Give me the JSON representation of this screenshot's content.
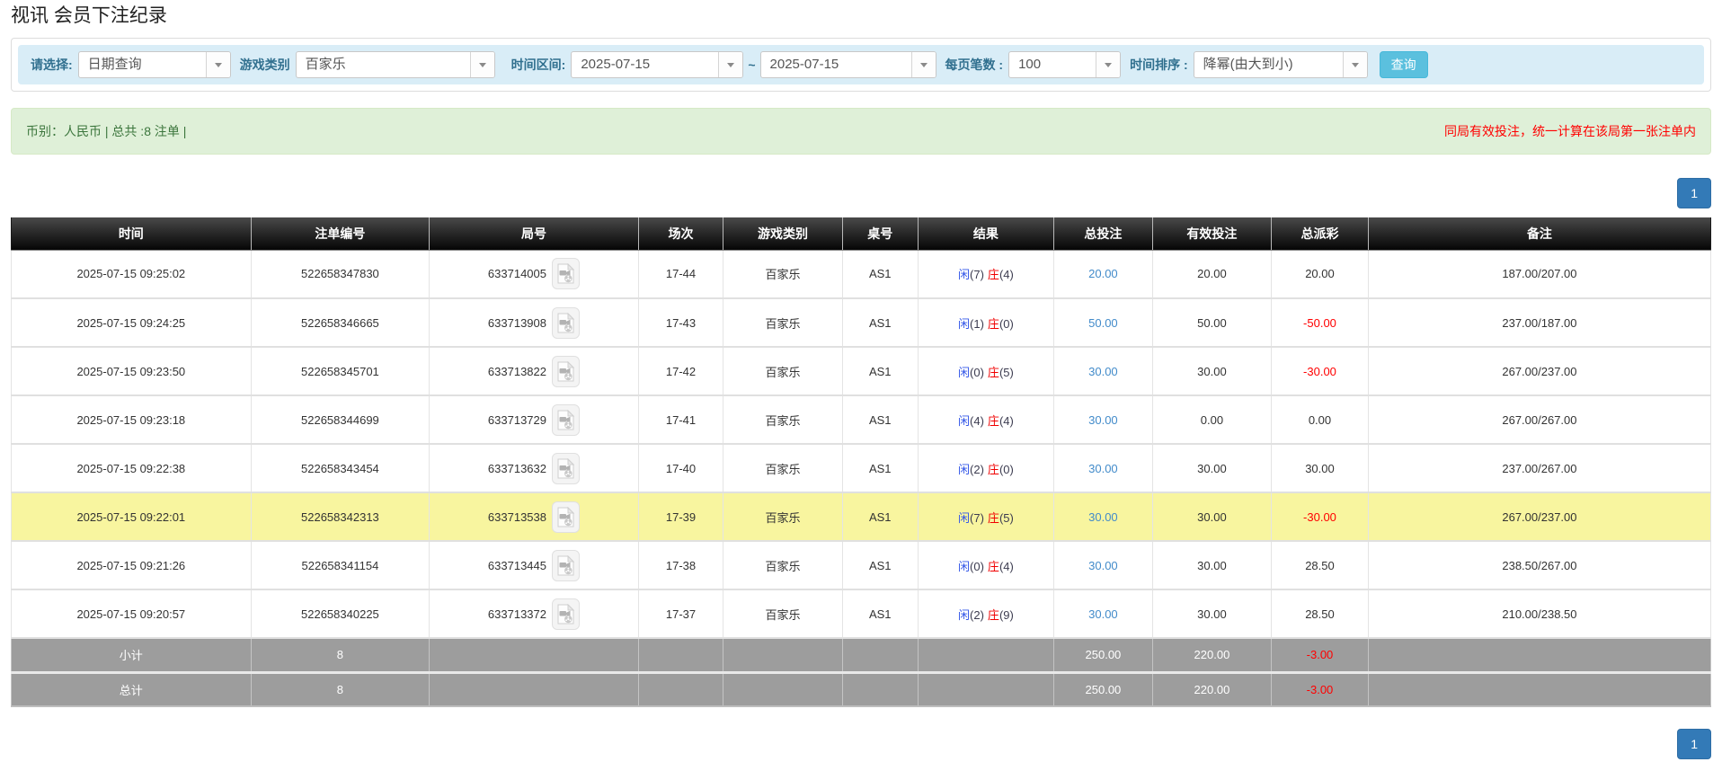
{
  "page": {
    "title": "视讯 会员下注纪录"
  },
  "colors": {
    "filter_bar_bg": "#d9edf7",
    "search_button": "#5bc0de",
    "summary_bg": "#dff0d8",
    "summary_text_green": "#3c763d",
    "alert_red": "#ff0000",
    "link_blue": "#428bca",
    "pagination_blue": "#337ab7",
    "highlight_yellow": "#f8f59f",
    "footer_gray": "#9d9d9d",
    "header_black": "#1a1a1a"
  },
  "filters": {
    "select_label": "请选择:",
    "select_value": "日期查询",
    "game_type_label": "游戏类别",
    "game_type_value": "百家乐",
    "time_range_label": "时间区间:",
    "date_from": "2025-07-15",
    "tilde": "~",
    "date_to": "2025-07-15",
    "page_size_label": "每页笔数 :",
    "page_size_value": "100",
    "sort_label": "时间排序 :",
    "sort_value": "降幂(由大到小)",
    "search_button": "查询"
  },
  "summary": {
    "left": "币别：人民币 | 总共 :8 注单 |",
    "right": "同局有效投注，统一计算在该局第一张注单内"
  },
  "pagination": {
    "top": "1",
    "bottom": "1"
  },
  "table": {
    "headers": [
      "时间",
      "注单编号",
      "局号",
      "场次",
      "游戏类别",
      "桌号",
      "结果",
      "总投注",
      "有效投注",
      "总派彩",
      "备注"
    ],
    "col_widths": [
      "14.1%",
      "10.5%",
      "12.3%",
      "5.0%",
      "7.0%",
      "4.45%",
      "8.0%",
      "5.8%",
      "7.0%",
      "5.7%",
      "20.15%"
    ],
    "rows": [
      {
        "time": "2025-07-15 09:25:02",
        "bet_id": "522658347830",
        "round": "633714005",
        "session": "17-44",
        "game": "百家乐",
        "table_no": "AS1",
        "result": {
          "player": "闲",
          "player_score": "(7)",
          "banker": "庄",
          "banker_score": "(4)"
        },
        "total_bet": "20.00",
        "valid_bet": "20.00",
        "payout": "20.00",
        "remark": "187.00/207.00",
        "highlighted": false
      },
      {
        "time": "2025-07-15 09:24:25",
        "bet_id": "522658346665",
        "round": "633713908",
        "session": "17-43",
        "game": "百家乐",
        "table_no": "AS1",
        "result": {
          "player": "闲",
          "player_score": "(1)",
          "banker": "庄",
          "banker_score": "(0)"
        },
        "total_bet": "50.00",
        "valid_bet": "50.00",
        "payout": "-50.00",
        "remark": "237.00/187.00",
        "highlighted": false
      },
      {
        "time": "2025-07-15 09:23:50",
        "bet_id": "522658345701",
        "round": "633713822",
        "session": "17-42",
        "game": "百家乐",
        "table_no": "AS1",
        "result": {
          "player": "闲",
          "player_score": "(0)",
          "banker": "庄",
          "banker_score": "(5)"
        },
        "total_bet": "30.00",
        "valid_bet": "30.00",
        "payout": "-30.00",
        "remark": "267.00/237.00",
        "highlighted": false
      },
      {
        "time": "2025-07-15 09:23:18",
        "bet_id": "522658344699",
        "round": "633713729",
        "session": "17-41",
        "game": "百家乐",
        "table_no": "AS1",
        "result": {
          "player": "闲",
          "player_score": "(4)",
          "banker": "庄",
          "banker_score": "(4)"
        },
        "total_bet": "30.00",
        "valid_bet": "0.00",
        "payout": "0.00",
        "remark": "267.00/267.00",
        "highlighted": false
      },
      {
        "time": "2025-07-15 09:22:38",
        "bet_id": "522658343454",
        "round": "633713632",
        "session": "17-40",
        "game": "百家乐",
        "table_no": "AS1",
        "result": {
          "player": "闲",
          "player_score": "(2)",
          "banker": "庄",
          "banker_score": "(0)"
        },
        "total_bet": "30.00",
        "valid_bet": "30.00",
        "payout": "30.00",
        "remark": "237.00/267.00",
        "highlighted": false
      },
      {
        "time": "2025-07-15 09:22:01",
        "bet_id": "522658342313",
        "round": "633713538",
        "session": "17-39",
        "game": "百家乐",
        "table_no": "AS1",
        "result": {
          "player": "闲",
          "player_score": "(7)",
          "banker": "庄",
          "banker_score": "(5)"
        },
        "total_bet": "30.00",
        "valid_bet": "30.00",
        "payout": "-30.00",
        "remark": "267.00/237.00",
        "highlighted": true
      },
      {
        "time": "2025-07-15 09:21:26",
        "bet_id": "522658341154",
        "round": "633713445",
        "session": "17-38",
        "game": "百家乐",
        "table_no": "AS1",
        "result": {
          "player": "闲",
          "player_score": "(0)",
          "banker": "庄",
          "banker_score": "(4)"
        },
        "total_bet": "30.00",
        "valid_bet": "30.00",
        "payout": "28.50",
        "remark": "238.50/267.00",
        "highlighted": false
      },
      {
        "time": "2025-07-15 09:20:57",
        "bet_id": "522658340225",
        "round": "633713372",
        "session": "17-37",
        "game": "百家乐",
        "table_no": "AS1",
        "result": {
          "player": "闲",
          "player_score": "(2)",
          "banker": "庄",
          "banker_score": "(9)"
        },
        "total_bet": "30.00",
        "valid_bet": "30.00",
        "payout": "28.50",
        "remark": "210.00/238.50",
        "highlighted": false
      }
    ],
    "footer": [
      {
        "label": "小计",
        "count": "8",
        "total_bet": "250.00",
        "valid_bet": "220.00",
        "payout": "-3.00",
        "remark": ""
      },
      {
        "label": "总计",
        "count": "8",
        "total_bet": "250.00",
        "valid_bet": "220.00",
        "payout": "-3.00",
        "remark": ""
      }
    ]
  }
}
